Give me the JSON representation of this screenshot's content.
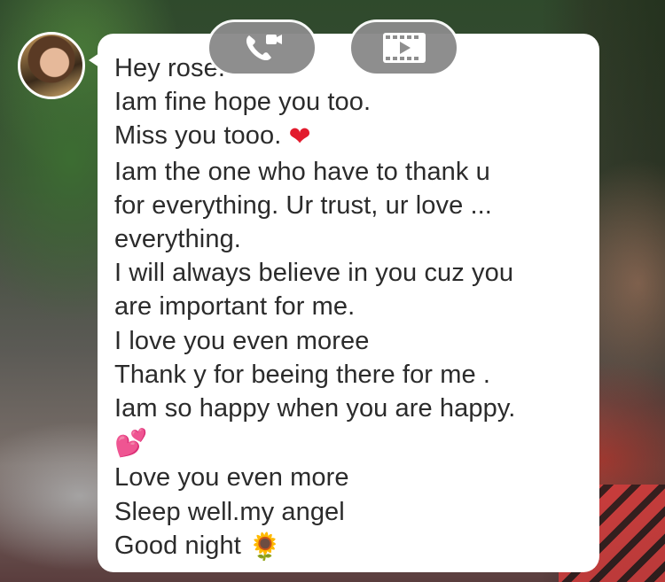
{
  "chat": {
    "messages": [
      {
        "text": "Hey rose."
      },
      {
        "text": "Iam fine hope you too."
      },
      {
        "text": "Miss you tooo.",
        "emoji": "❤"
      },
      {
        "text": "Iam the one who have to thank u"
      },
      {
        "text": "for everything. Ur trust, ur love ..."
      },
      {
        "text": "everything."
      },
      {
        "text": "I will always believe in you cuz you"
      },
      {
        "text": "are important for me."
      },
      {
        "text": "I love you even moree"
      },
      {
        "text": "Thank y for beeing there for me ."
      },
      {
        "text": "Iam so happy when you are happy."
      },
      {
        "text": "",
        "emoji": "💕"
      },
      {
        "text": "Love you even more"
      },
      {
        "text": "Sleep well.my angel"
      },
      {
        "text": "Good night",
        "emoji": "🌻"
      }
    ]
  },
  "controls": {
    "voice_call_icon": "phone-call-icon",
    "video_call_icon": "film-play-icon"
  },
  "colors": {
    "bubble": "#ffffff",
    "text": "#2b2b2b",
    "button": "#8a8a8a"
  }
}
